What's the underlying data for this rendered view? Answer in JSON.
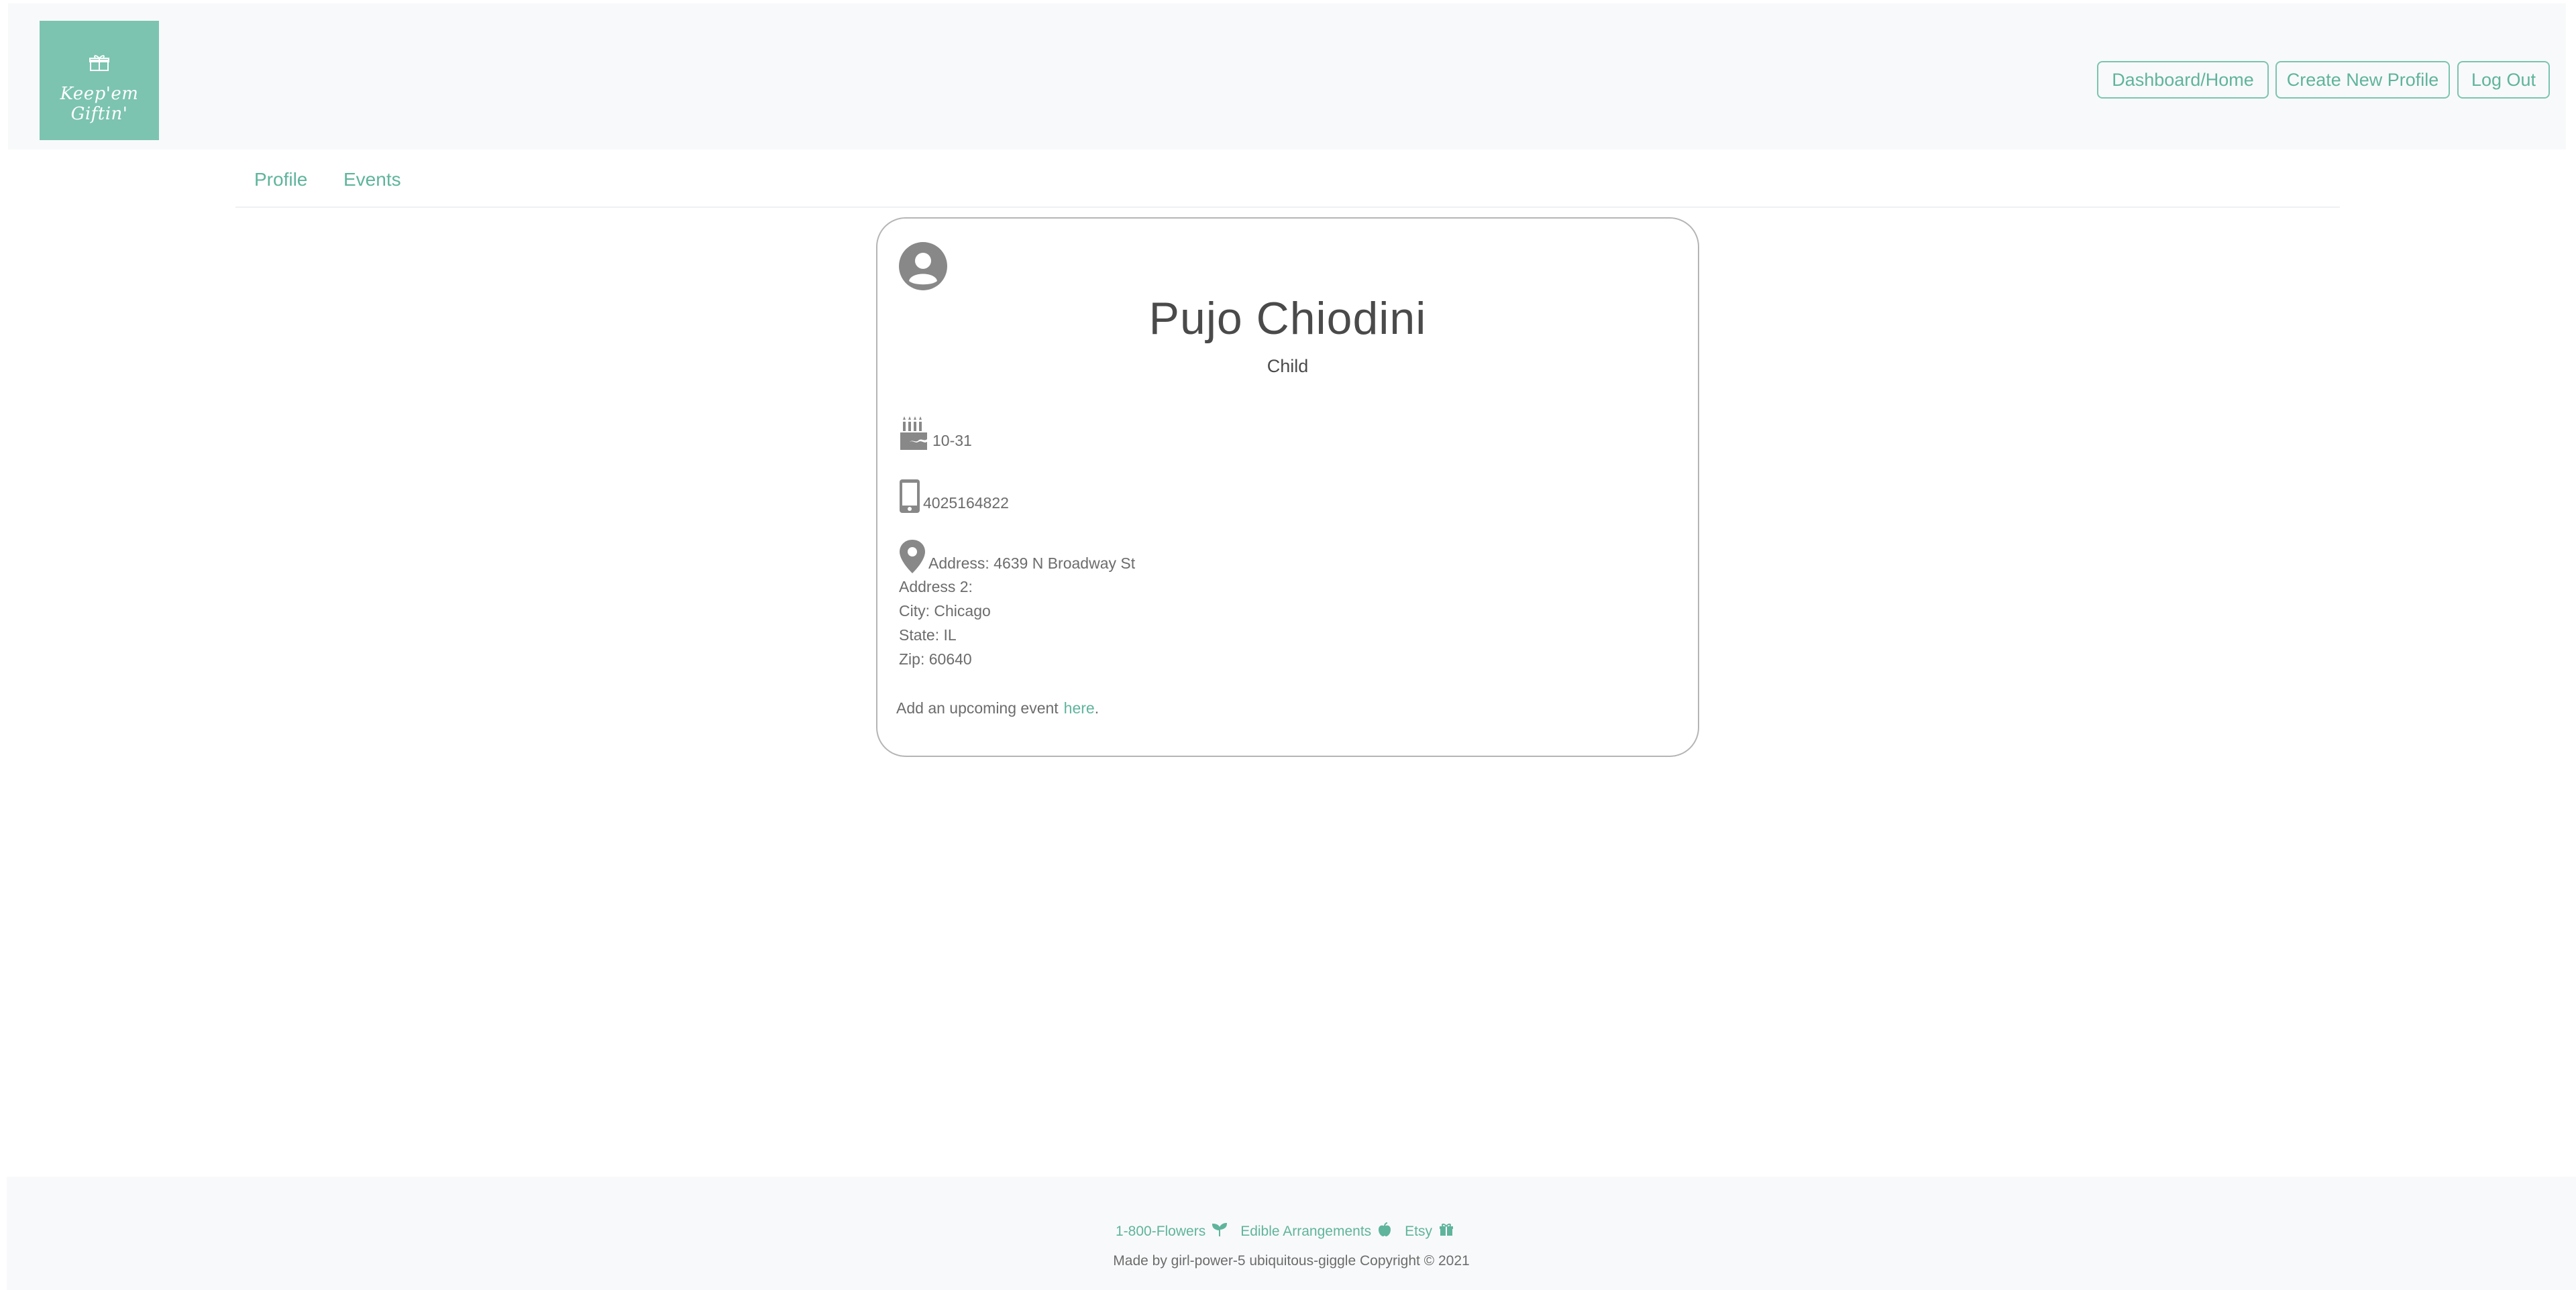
{
  "brand": {
    "logo_text": "Keep'em Giftin'"
  },
  "header": {
    "buttons": [
      "Dashboard/Home",
      "Create New Profile",
      "Log Out"
    ]
  },
  "tabs": [
    "Profile",
    "Events"
  ],
  "profile": {
    "name": "Pujo Chiodini",
    "relationship": "Child",
    "birthday": "10-31",
    "phone": "4025164822",
    "address": "Address: 4639 N Broadway St",
    "address2": "Address 2:",
    "city": "City: Chicago",
    "state": "State: IL",
    "zip": "Zip: 60640",
    "event_prompt": "Add an upcoming event",
    "event_link": "here",
    "event_suffix": "."
  },
  "footer": {
    "links": [
      {
        "label": "1-800-Flowers",
        "icon": "seedling-icon"
      },
      {
        "label": "Edible Arrangements",
        "icon": "apple-icon"
      },
      {
        "label": "Etsy",
        "icon": "gift-icon"
      }
    ],
    "copyright": "Made by girl-power-5 ubiquitous-giggle Copyright © 2021"
  },
  "colors": {
    "brand": "#7cc4b0",
    "link": "#5fb49c",
    "text": "#6c6c6c",
    "heading": "#4a4a4a"
  }
}
